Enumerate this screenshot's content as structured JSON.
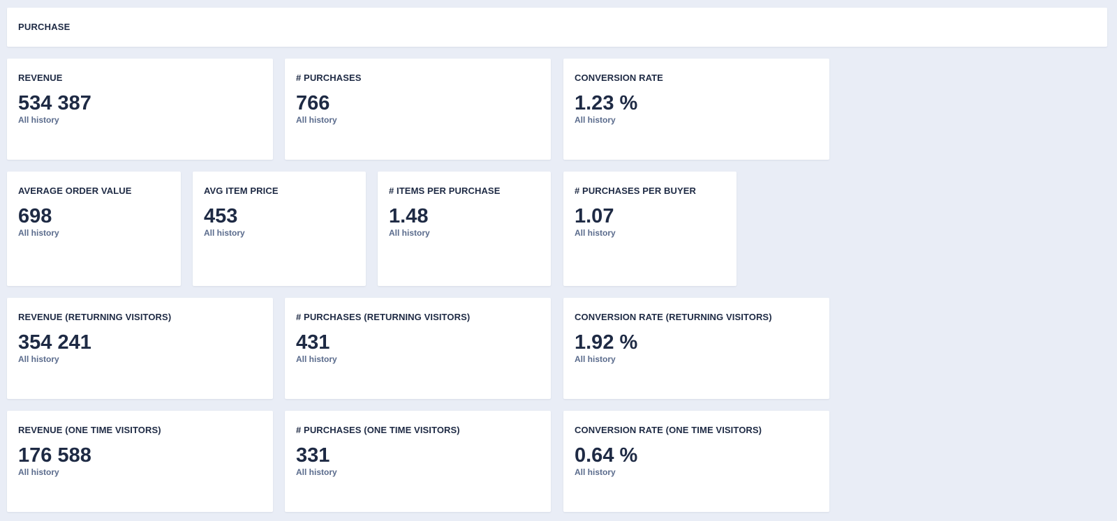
{
  "header": {
    "title": "PURCHASE"
  },
  "rows": [
    [
      {
        "title": "REVENUE",
        "value": "534 387",
        "sub": "All history"
      },
      {
        "title": "# PURCHASES",
        "value": "766",
        "sub": "All history"
      },
      {
        "title": "CONVERSION RATE",
        "value": "1.23 %",
        "sub": "All history"
      }
    ],
    [
      {
        "title": "AVERAGE ORDER VALUE",
        "value": "698",
        "sub": "All history"
      },
      {
        "title": "AVG ITEM PRICE",
        "value": "453",
        "sub": "All history"
      },
      {
        "title": "# ITEMS PER PURCHASE",
        "value": "1.48",
        "sub": "All history"
      },
      {
        "title": "# PURCHASES PER BUYER",
        "value": "1.07",
        "sub": "All history"
      }
    ],
    [
      {
        "title": "REVENUE (RETURNING VISITORS)",
        "value": "354 241",
        "sub": "All history"
      },
      {
        "title": "# PURCHASES (RETURNING VISITORS)",
        "value": "431",
        "sub": "All history"
      },
      {
        "title": "CONVERSION RATE (RETURNING VISITORS)",
        "value": "1.92 %",
        "sub": "All history"
      }
    ],
    [
      {
        "title": "REVENUE (ONE TIME VISITORS)",
        "value": "176 588",
        "sub": "All history"
      },
      {
        "title": "# PURCHASES (ONE TIME VISITORS)",
        "value": "331",
        "sub": "All history"
      },
      {
        "title": "CONVERSION RATE (ONE TIME VISITORS)",
        "value": "0.64 %",
        "sub": "All history"
      }
    ]
  ]
}
